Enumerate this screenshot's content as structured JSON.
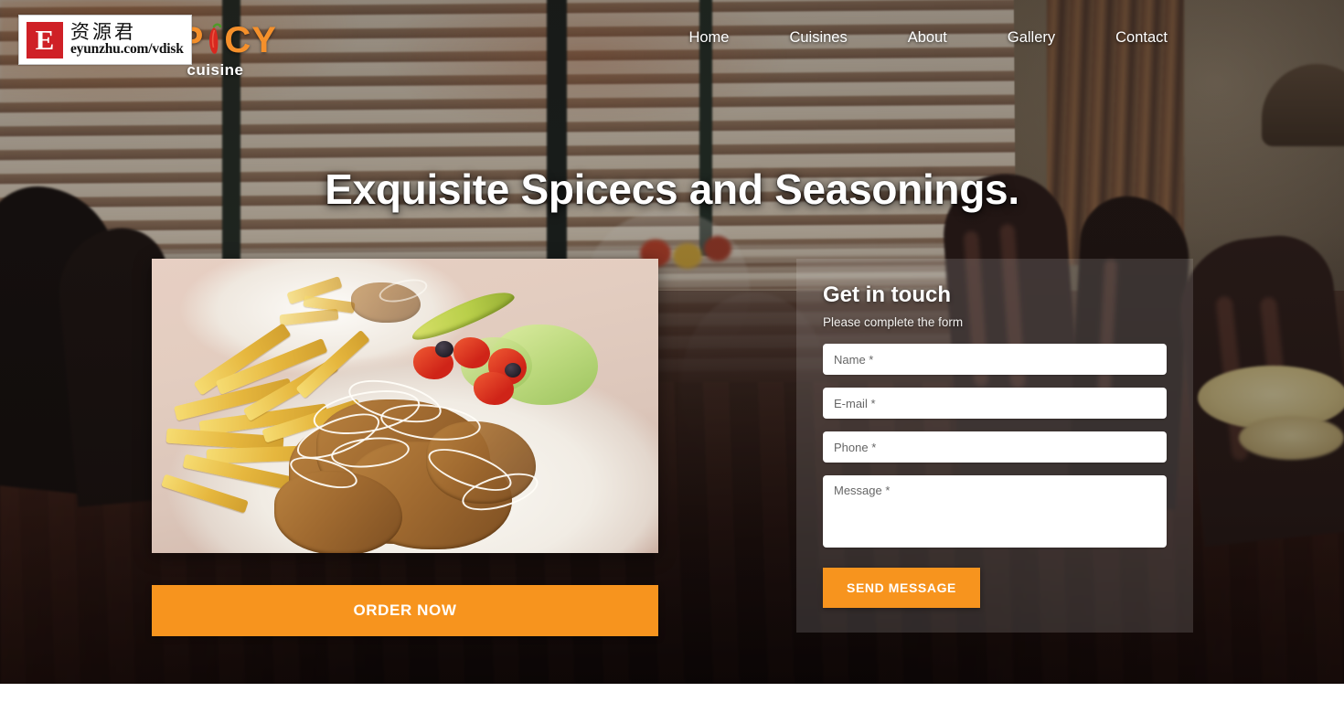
{
  "site": {
    "logo": {
      "word_prefix": "SP",
      "chili_icon": "chili-pepper-icon",
      "word_suffix": "CY",
      "tagline": "cuisine"
    },
    "nav": [
      {
        "label": "Home"
      },
      {
        "label": "Cuisines"
      },
      {
        "label": "About"
      },
      {
        "label": "Gallery"
      },
      {
        "label": "Contact"
      }
    ]
  },
  "hero": {
    "title": "Exquisite Spicecs and Seasonings.",
    "food_image_alt": "kebab-plate-with-fries",
    "order_button": "ORDER NOW"
  },
  "contact_form": {
    "title": "Get in touch",
    "subtitle": "Please complete the form",
    "fields": [
      {
        "name": "name",
        "placeholder": "Name *",
        "value": ""
      },
      {
        "name": "email",
        "placeholder": "E-mail *",
        "value": ""
      },
      {
        "name": "phone",
        "placeholder": "Phone *",
        "value": ""
      },
      {
        "name": "message",
        "placeholder": "Message *",
        "value": ""
      }
    ],
    "submit_label": "SEND MESSAGE"
  },
  "watermark": {
    "badge_letter": "E",
    "chinese": "资源君",
    "url": "eyunzhu.com/vdisk"
  },
  "colors": {
    "accent": "#f7941e",
    "logo_orange": "#f5902b",
    "watermark_red": "#cf2026",
    "text_light": "#ffffff"
  }
}
